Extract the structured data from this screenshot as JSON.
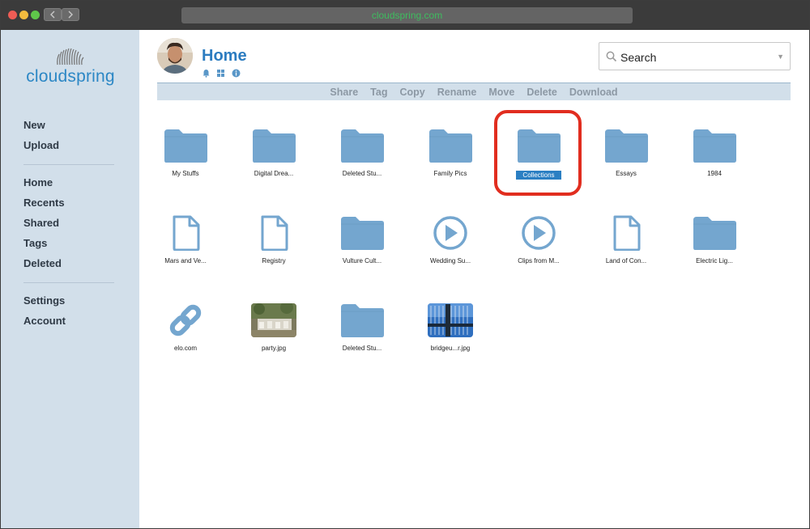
{
  "browser": {
    "url": "cloudspring.com"
  },
  "brand": {
    "name": "cloudspring"
  },
  "sidebar": {
    "group1": [
      {
        "label": "New"
      },
      {
        "label": "Upload"
      }
    ],
    "group2": [
      {
        "label": "Home"
      },
      {
        "label": "Recents"
      },
      {
        "label": "Shared"
      },
      {
        "label": "Tags"
      },
      {
        "label": "Deleted"
      }
    ],
    "group3": [
      {
        "label": "Settings"
      },
      {
        "label": "Account"
      }
    ]
  },
  "header": {
    "title": "Home",
    "icons": [
      "bell-icon",
      "grid-icon",
      "info-icon"
    ]
  },
  "search": {
    "value": "Search"
  },
  "toolbar": {
    "actions": [
      "Share",
      "Tag",
      "Copy",
      "Rename",
      "Move",
      "Delete",
      "Download"
    ]
  },
  "files": [
    {
      "name": "My Stuffs",
      "type": "folder"
    },
    {
      "name": "Digital Drea...",
      "type": "folder"
    },
    {
      "name": "Deleted Stu...",
      "type": "folder"
    },
    {
      "name": "Family Pics",
      "type": "folder"
    },
    {
      "name": "Collections",
      "type": "folder",
      "selected": true
    },
    {
      "name": "Essays",
      "type": "folder"
    },
    {
      "name": "1984",
      "type": "folder"
    },
    {
      "name": "Mars and Ve...",
      "type": "document"
    },
    {
      "name": "Registry",
      "type": "document"
    },
    {
      "name": "Vulture Cult...",
      "type": "folder"
    },
    {
      "name": "Wedding Su...",
      "type": "video"
    },
    {
      "name": "Clips from M...",
      "type": "video"
    },
    {
      "name": "Land of Con...",
      "type": "document"
    },
    {
      "name": "Electric Lig...",
      "type": "folder"
    },
    {
      "name": "elo.com",
      "type": "link"
    },
    {
      "name": "party.jpg",
      "type": "image-party"
    },
    {
      "name": "Deleted Stu...",
      "type": "folder"
    },
    {
      "name": "bridgeu...r.jpg",
      "type": "image-bridge"
    }
  ],
  "colors": {
    "accent": "#2c7cc0",
    "folder": "#74a6cf",
    "sidebar": "#d2dfea",
    "highlight": "#e12d1f"
  }
}
